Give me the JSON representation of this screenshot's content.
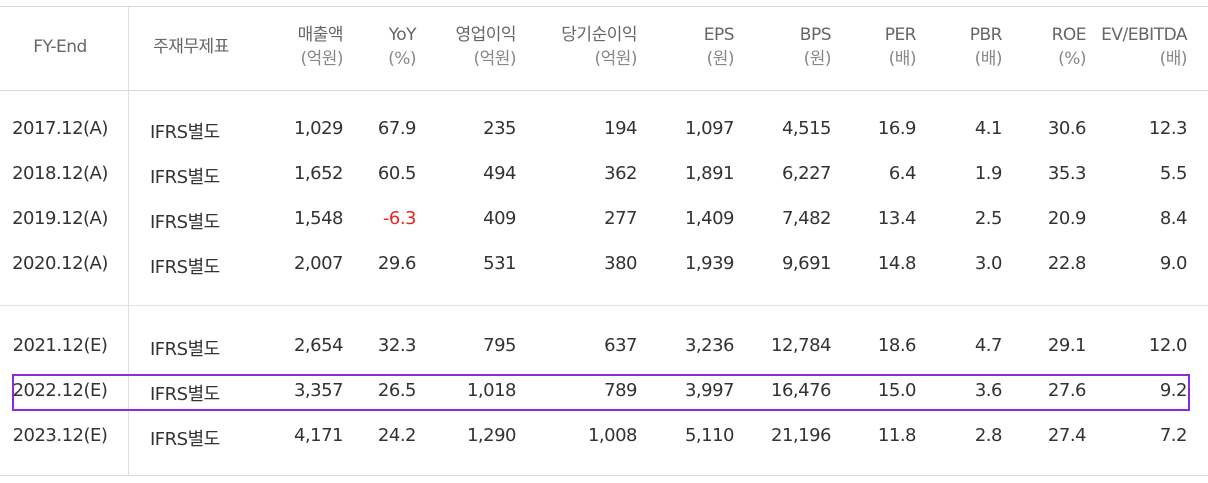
{
  "headers": [
    {
      "label": "FY-End",
      "unit": ""
    },
    {
      "label": "주재무제표",
      "unit": ""
    },
    {
      "label": "매출액",
      "unit": "(억원)"
    },
    {
      "label": "YoY",
      "unit": "(%)"
    },
    {
      "label": "영업이익",
      "unit": "(억원)"
    },
    {
      "label": "당기순이익",
      "unit": "(억원)"
    },
    {
      "label": "EPS",
      "unit": "(원)"
    },
    {
      "label": "BPS",
      "unit": "(원)"
    },
    {
      "label": "PER",
      "unit": "(배)"
    },
    {
      "label": "PBR",
      "unit": "(배)"
    },
    {
      "label": "ROE",
      "unit": "(%)"
    },
    {
      "label": "EV/EBITDA",
      "unit": "(배)"
    }
  ],
  "rows": [
    {
      "cells": [
        "2017.12(A)",
        "IFRS별도",
        "1,029",
        "67.9",
        "235",
        "194",
        "1,097",
        "4,515",
        "16.9",
        "4.1",
        "30.6",
        "12.3"
      ],
      "negative_col": -1,
      "highlighted": false
    },
    {
      "cells": [
        "2018.12(A)",
        "IFRS별도",
        "1,652",
        "60.5",
        "494",
        "362",
        "1,891",
        "6,227",
        "6.4",
        "1.9",
        "35.3",
        "5.5"
      ],
      "negative_col": -1,
      "highlighted": false
    },
    {
      "cells": [
        "2019.12(A)",
        "IFRS별도",
        "1,548",
        "-6.3",
        "409",
        "277",
        "1,409",
        "7,482",
        "13.4",
        "2.5",
        "20.9",
        "8.4"
      ],
      "negative_col": 3,
      "highlighted": false
    },
    {
      "cells": [
        "2020.12(A)",
        "IFRS별도",
        "2,007",
        "29.6",
        "531",
        "380",
        "1,939",
        "9,691",
        "14.8",
        "3.0",
        "22.8",
        "9.0"
      ],
      "negative_col": -1,
      "highlighted": false
    },
    {
      "cells": [
        "2021.12(E)",
        "IFRS별도",
        "2,654",
        "32.3",
        "795",
        "637",
        "3,236",
        "12,784",
        "18.6",
        "4.7",
        "29.1",
        "12.0"
      ],
      "negative_col": -1,
      "highlighted": false
    },
    {
      "cells": [
        "2022.12(E)",
        "IFRS별도",
        "3,357",
        "26.5",
        "1,018",
        "789",
        "3,997",
        "16,476",
        "15.0",
        "3.6",
        "27.6",
        "9.2"
      ],
      "negative_col": -1,
      "highlighted": true
    },
    {
      "cells": [
        "2023.12(E)",
        "IFRS별도",
        "4,171",
        "24.2",
        "1,290",
        "1,008",
        "5,110",
        "21,196",
        "11.8",
        "2.8",
        "27.4",
        "7.2"
      ],
      "negative_col": -1,
      "highlighted": false
    }
  ],
  "colors": {
    "negative": "#e8251f",
    "highlight_border": "#8a2be2",
    "text": "#333333",
    "header_text": "#666666"
  }
}
